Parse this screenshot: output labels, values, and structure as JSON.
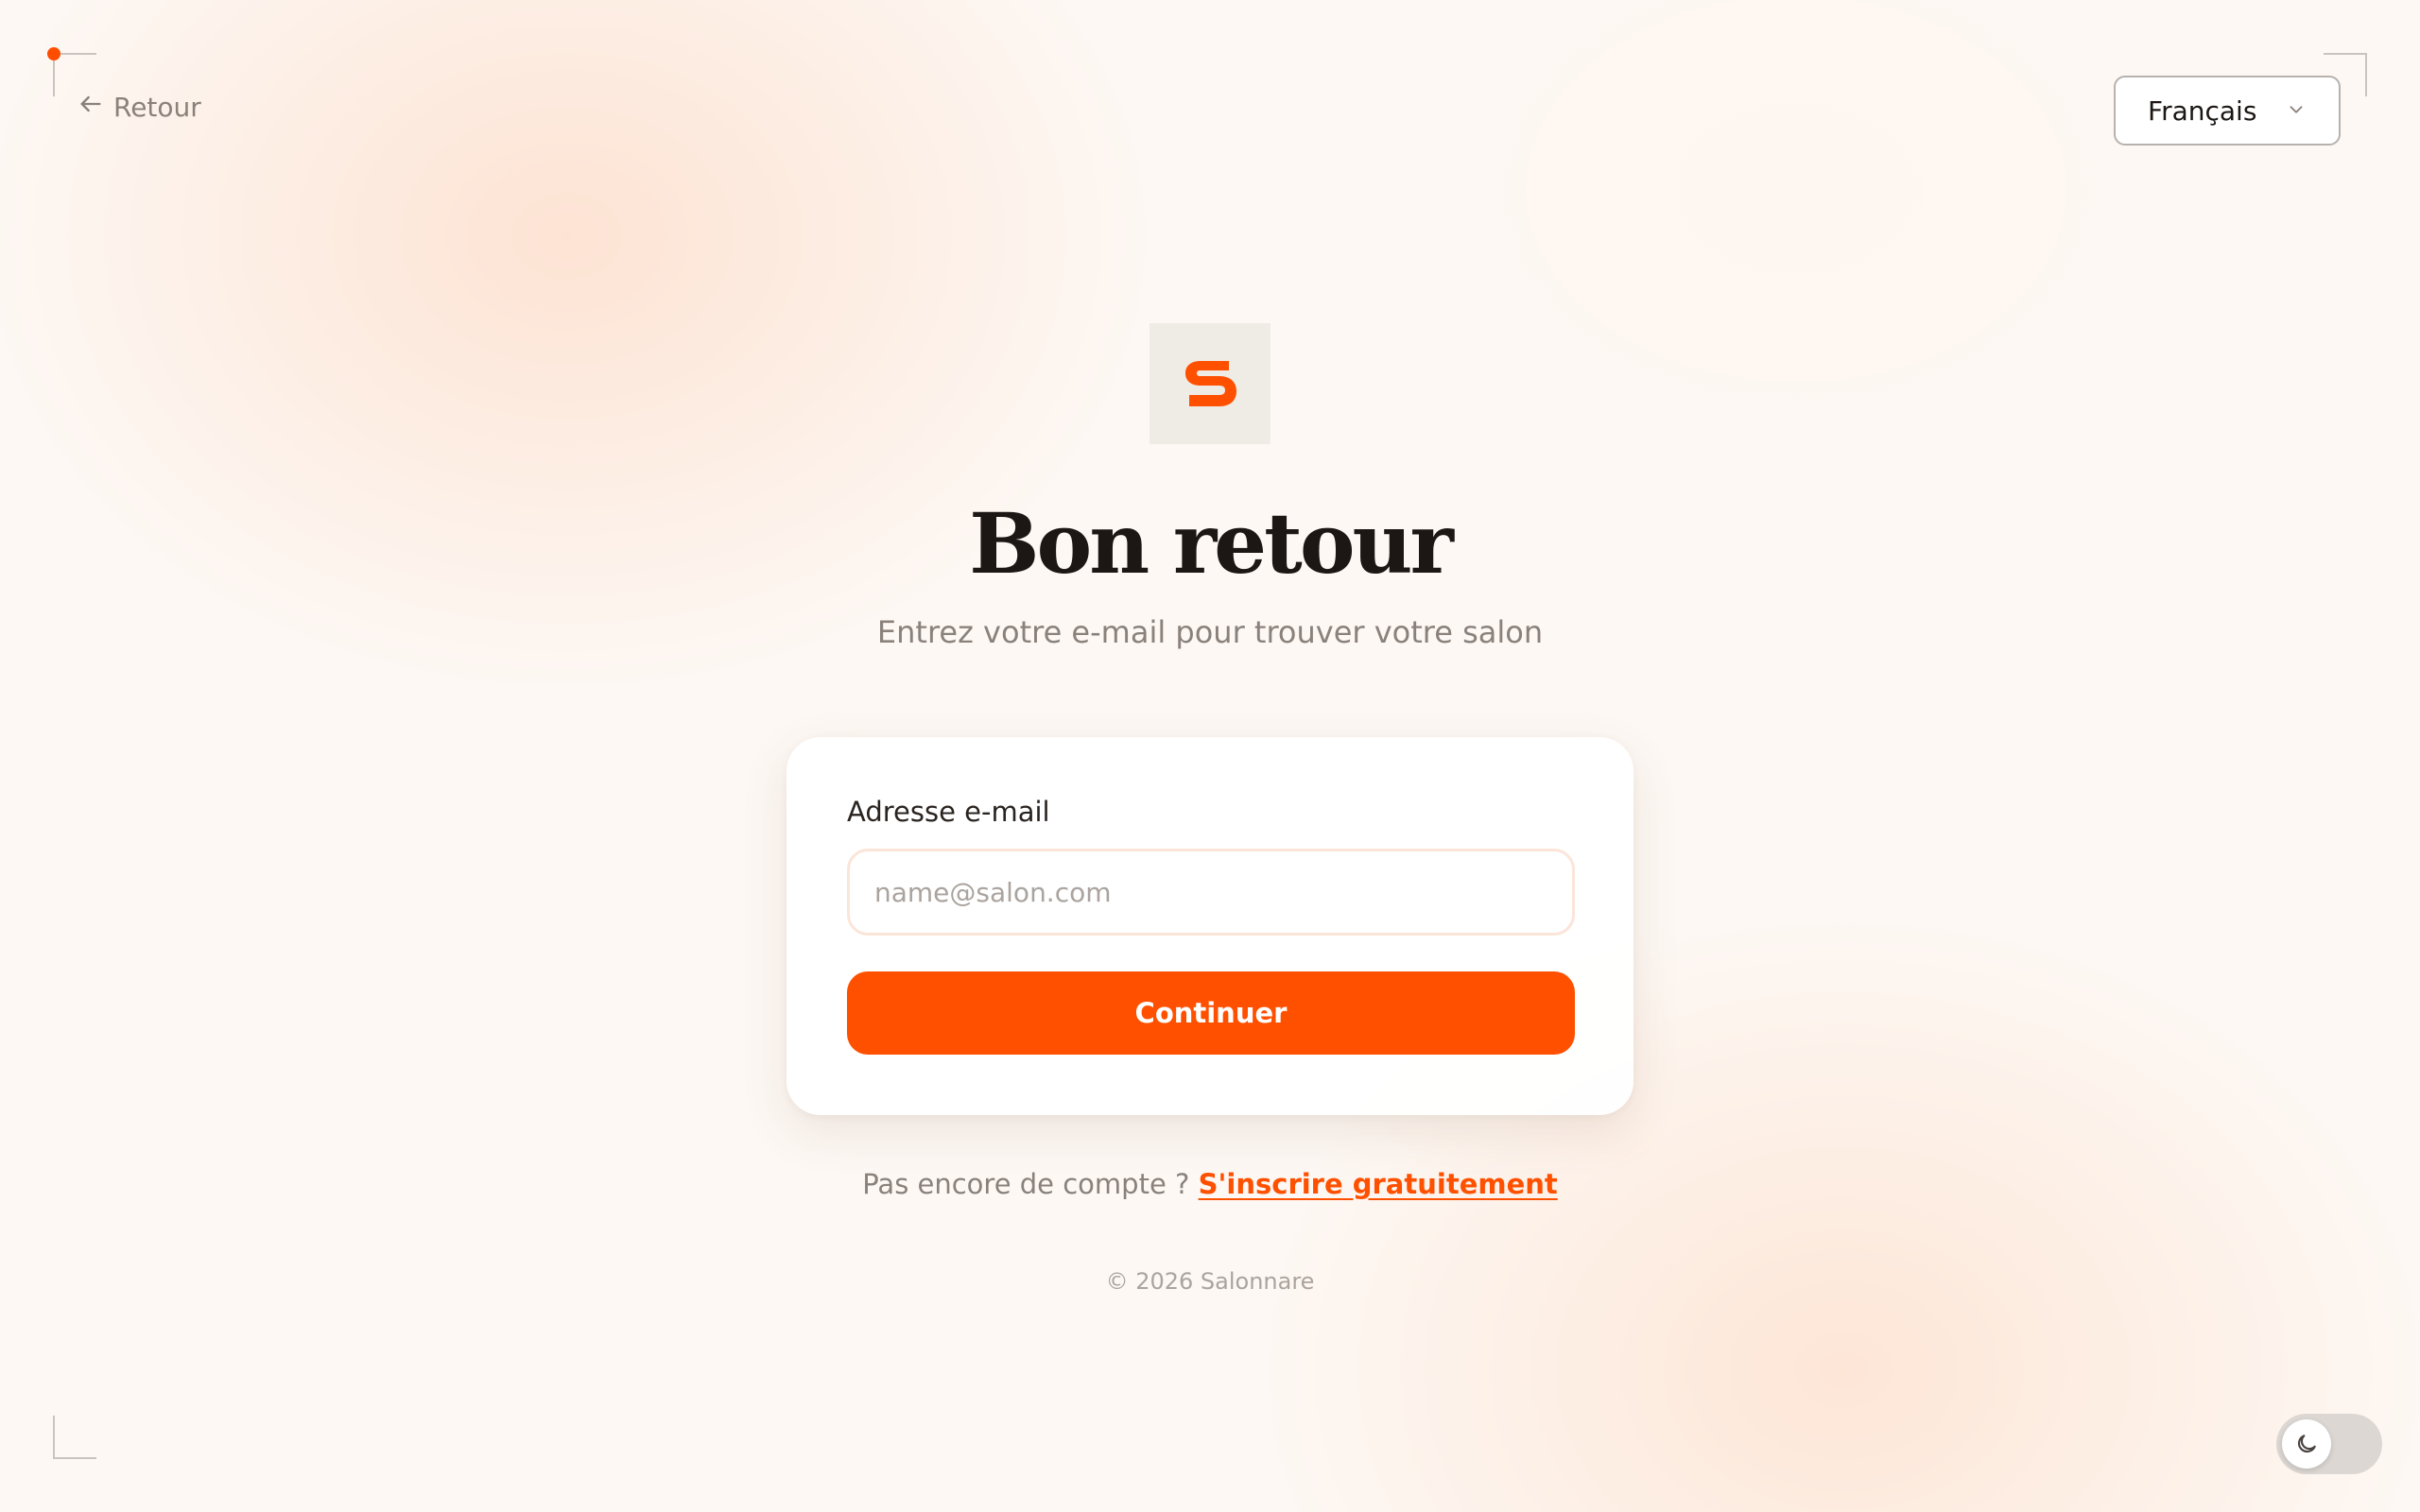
{
  "nav": {
    "back_label": "Retour",
    "back_icon": "arrow-left-icon"
  },
  "language": {
    "selected": "Français",
    "icon": "chevron-down-icon"
  },
  "brand": {
    "logo_letter": "S",
    "accent_color": "#ff5000",
    "logo_tile_color": "#efebe5"
  },
  "hero": {
    "title": "Bon retour",
    "subtitle": "Entrez votre e-mail pour trouver votre salon"
  },
  "form": {
    "email_label": "Adresse e-mail",
    "email_placeholder": "name@salon.com",
    "email_value": "",
    "submit_label": "Continuer"
  },
  "signup": {
    "prompt": "Pas encore de compte ?",
    "link_label": "S'inscrire gratuitement"
  },
  "footer": {
    "copyright": "© 2026 Salonnare"
  },
  "theme_toggle": {
    "icon": "moon-icon",
    "mode": "light"
  }
}
